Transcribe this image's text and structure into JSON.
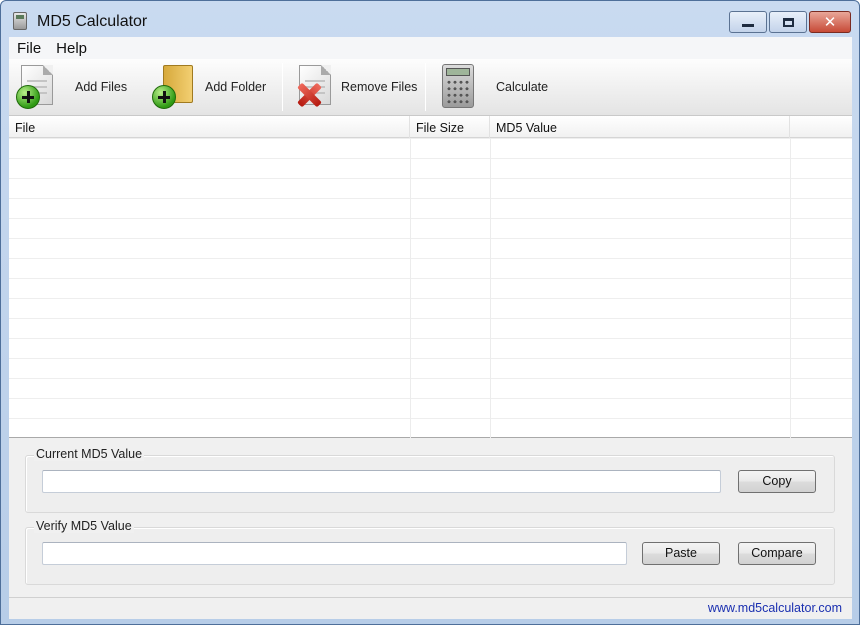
{
  "window": {
    "title": "MD5 Calculator"
  },
  "menu": {
    "items": [
      {
        "label": "File"
      },
      {
        "label": "Help"
      }
    ]
  },
  "toolbar": {
    "add_files": "Add Files",
    "add_folder": "Add Folder",
    "remove_files": "Remove Files",
    "calculate": "Calculate"
  },
  "table": {
    "columns": [
      "File",
      "File Size",
      "MD5 Value"
    ],
    "rows": []
  },
  "current_md5": {
    "label": "Current MD5 Value",
    "value": "",
    "copy_label": "Copy"
  },
  "verify_md5": {
    "label": "Verify MD5 Value",
    "value": "",
    "paste_label": "Paste",
    "compare_label": "Compare"
  },
  "status": {
    "link": "www.md5calculator.com"
  }
}
